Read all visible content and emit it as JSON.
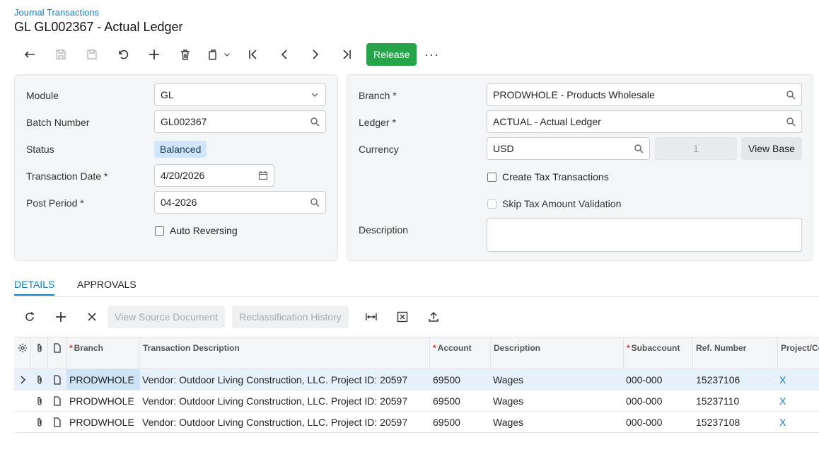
{
  "header": {
    "breadcrumb": "Journal Transactions",
    "title": "GL GL002367 - Actual Ledger"
  },
  "toolbar": {
    "icons": [
      "back-icon",
      "save-icon",
      "save-close-icon",
      "undo-icon",
      "add-icon",
      "delete-icon",
      "copy-paste-icon",
      "first-icon",
      "previous-icon",
      "next-icon",
      "last-icon"
    ],
    "release_label": "Release",
    "more_label": "···"
  },
  "form_left": {
    "module_label": "Module",
    "module_value": "GL",
    "batch_label": "Batch Number",
    "batch_value": "GL002367",
    "status_label": "Status",
    "status_value": "Balanced",
    "date_label": "Transaction Date",
    "date_value": "4/20/2026",
    "period_label": "Post Period",
    "period_value": "04-2026",
    "auto_reversing_label": "Auto Reversing",
    "required_mark": "*"
  },
  "form_right": {
    "branch_label": "Branch",
    "branch_value": "PRODWHOLE - Products Wholesale",
    "ledger_label": "Ledger",
    "ledger_value": "ACTUAL - Actual Ledger",
    "currency_label": "Currency",
    "currency_value": "USD",
    "rate_value": "1",
    "view_base_label": "View Base",
    "create_tax_label": "Create Tax Transactions",
    "skip_tax_label": "Skip Tax Amount Validation",
    "description_label": "Description",
    "description_value": ""
  },
  "tabs": [
    "DETAILS",
    "APPROVALS"
  ],
  "grid_toolbar": {
    "view_source_label": "View Source Document",
    "reclass_label": "Reclassification History"
  },
  "grid": {
    "columns": {
      "branch": "Branch",
      "trans_desc": "Transaction Description",
      "account": "Account",
      "description": "Description",
      "subaccount": "Subaccount",
      "ref_number": "Ref. Number",
      "project": "Project/Co"
    },
    "rows": [
      {
        "branch": "PRODWHOLE",
        "trans_desc": "Vendor: Outdoor Living Construction, LLC. Project ID: 20597",
        "account": "69500",
        "description": "Wages",
        "subaccount": "000-000",
        "ref_number": "15237106",
        "project": "X"
      },
      {
        "branch": "PRODWHOLE",
        "trans_desc": "Vendor: Outdoor Living Construction, LLC. Project ID: 20597",
        "account": "69500",
        "description": "Wages",
        "subaccount": "000-000",
        "ref_number": "15237110",
        "project": "X"
      },
      {
        "branch": "PRODWHOLE",
        "trans_desc": "Vendor: Outdoor Living Construction, LLC. Project ID: 20597",
        "account": "69500",
        "description": "Wages",
        "subaccount": "000-000",
        "ref_number": "15237108",
        "project": "X"
      }
    ]
  },
  "colors": {
    "accent": "#0b7fc0",
    "release": "#27a34a",
    "required": "#d0342c"
  }
}
